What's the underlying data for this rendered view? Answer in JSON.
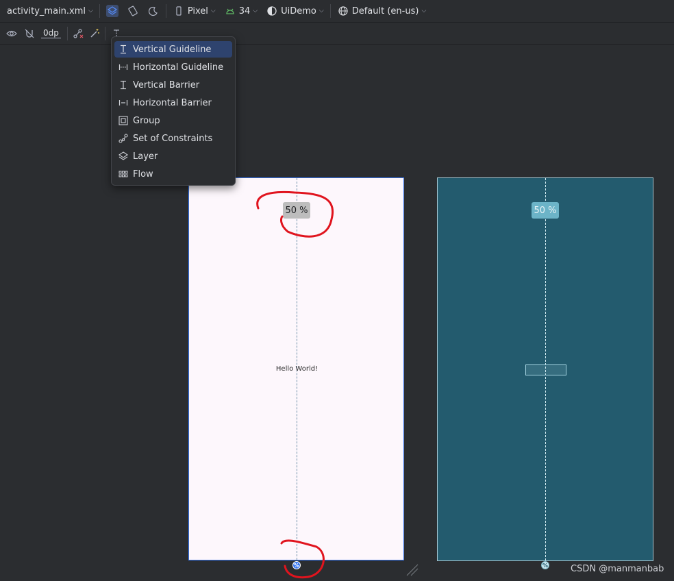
{
  "toolbar": {
    "file_name": "activity_main.xml",
    "device": "Pixel",
    "api_level": "34",
    "theme": "UiDemo",
    "locale": "Default (en-us)",
    "margin_value": "0dp"
  },
  "guidelines_menu": {
    "items": [
      {
        "label": "Vertical Guideline",
        "icon": "vertical-guideline-icon"
      },
      {
        "label": "Horizontal Guideline",
        "icon": "horizontal-guideline-icon"
      },
      {
        "label": "Vertical Barrier",
        "icon": "vertical-barrier-icon"
      },
      {
        "label": "Horizontal Barrier",
        "icon": "horizontal-barrier-icon"
      },
      {
        "label": "Group",
        "icon": "group-icon"
      },
      {
        "label": "Set of Constraints",
        "icon": "constraints-icon"
      },
      {
        "label": "Layer",
        "icon": "layer-icon"
      },
      {
        "label": "Flow",
        "icon": "flow-icon"
      }
    ],
    "selected": "Vertical Guideline"
  },
  "design_view": {
    "guideline_percent": "50 %",
    "text_view": "Hello World!"
  },
  "blueprint_view": {
    "guideline_percent": "50 %"
  },
  "watermark": "CSDN @manmanbab",
  "colors": {
    "accent": "#3574f0",
    "blueprint_bg": "#235b6e",
    "annotation": "#e0141e"
  }
}
